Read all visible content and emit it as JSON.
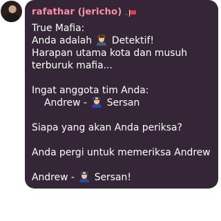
{
  "message": {
    "sender": "rafathar (jericho)",
    "lines": [
      {
        "text": "True Mafia:"
      },
      {
        "pre": "Anda adalah ",
        "emoji": "detective-emoji",
        "post": " Detektif!"
      },
      {
        "text": "Harapan utama kota dan musuh"
      },
      {
        "text": "terburuk mafia..."
      },
      {
        "text": ""
      },
      {
        "text": "Ingat anggota tim Anda:"
      },
      {
        "pre": "Andrew - ",
        "emoji": "police-officer-emoji",
        "post": " Sersan",
        "indent": true
      },
      {
        "text": ""
      },
      {
        "text": "Siapa yang akan Anda periksa?"
      },
      {
        "text": ""
      },
      {
        "text": "Anda pergi untuk memeriksa Andrew"
      },
      {
        "text": ""
      },
      {
        "pre": "Andrew - ",
        "emoji": "police-officer-emoji",
        "post": " Sersan!"
      }
    ]
  },
  "colors": {
    "bubble": "#352637",
    "sender": "#ff8fa3",
    "text": "#ffffff"
  }
}
